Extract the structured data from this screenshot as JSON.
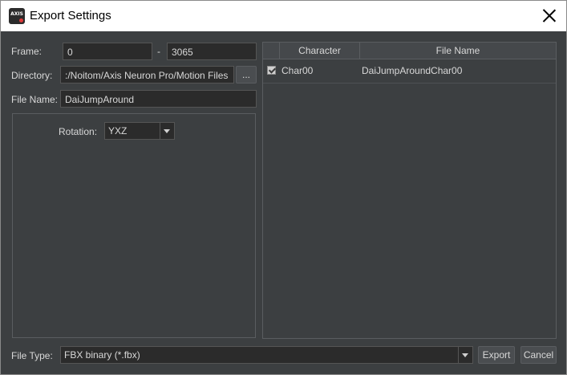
{
  "window": {
    "title": "Export Settings",
    "app_icon_text": "AXIS"
  },
  "frame": {
    "label": "Frame:",
    "start": "0",
    "separator": "-",
    "end": "3065"
  },
  "directory": {
    "label": "Directory:",
    "value": ":/Noitom/Axis Neuron Pro/Motion Files",
    "browse_label": "..."
  },
  "file_name": {
    "label": "File Name:",
    "value": "DaiJumpAround"
  },
  "rotation": {
    "label": "Rotation:",
    "selected": "YXZ"
  },
  "table": {
    "columns": [
      "Character",
      "File Name"
    ],
    "rows": [
      {
        "checked": true,
        "character": "Char00",
        "file_name": "DaiJumpAroundChar00"
      }
    ]
  },
  "file_type": {
    "label": "File Type:",
    "selected": "FBX binary (*.fbx)"
  },
  "buttons": {
    "export": "Export",
    "cancel": "Cancel"
  }
}
